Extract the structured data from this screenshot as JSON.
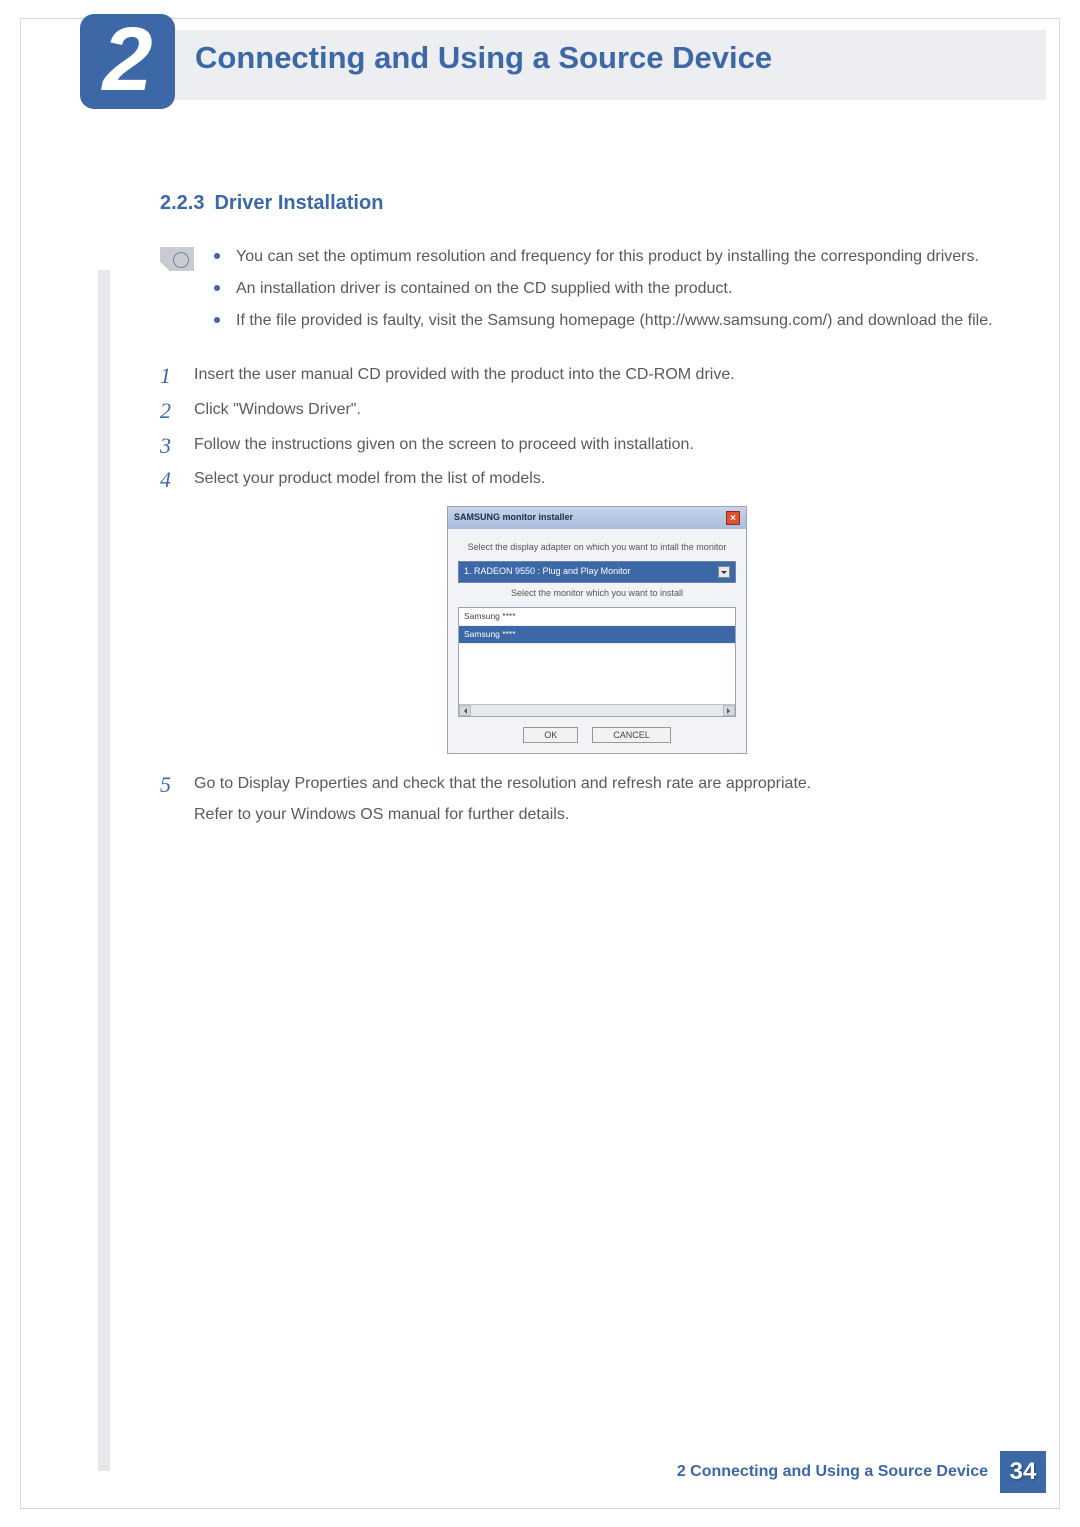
{
  "chapter": {
    "number": "2",
    "title": "Connecting and Using a Source Device"
  },
  "section": {
    "number": "2.2.3",
    "title": "Driver Installation"
  },
  "notes": [
    "You can set the optimum resolution and frequency for this product by installing the corresponding drivers.",
    "An installation driver is contained on the CD supplied with the product.",
    "If the file provided is faulty, visit the Samsung homepage (http://www.samsung.com/) and download the file."
  ],
  "steps": {
    "s1": "Insert the user manual CD provided with the product into the CD-ROM drive.",
    "s2": "Click \"Windows Driver\".",
    "s3": "Follow the instructions given on the screen to proceed with installation.",
    "s4": "Select your product model from the list of models.",
    "s5": "Go to Display Properties and check that the resolution and refresh rate are appropriate.",
    "s5b": "Refer to your Windows OS manual for further details."
  },
  "installer": {
    "title": "SAMSUNG monitor installer",
    "label_adapter": "Select the display adapter on which you want to intall the monitor",
    "adapter_value": "1. RADEON 9550 : Plug and Play Monitor",
    "label_monitor": "Select the monitor which you want to install",
    "list_item1": "Samsung ****",
    "list_item2": "Samsung ****",
    "ok": "OK",
    "cancel": "CANCEL"
  },
  "footer": {
    "text": "2 Connecting and Using a Source Device",
    "page": "34"
  }
}
